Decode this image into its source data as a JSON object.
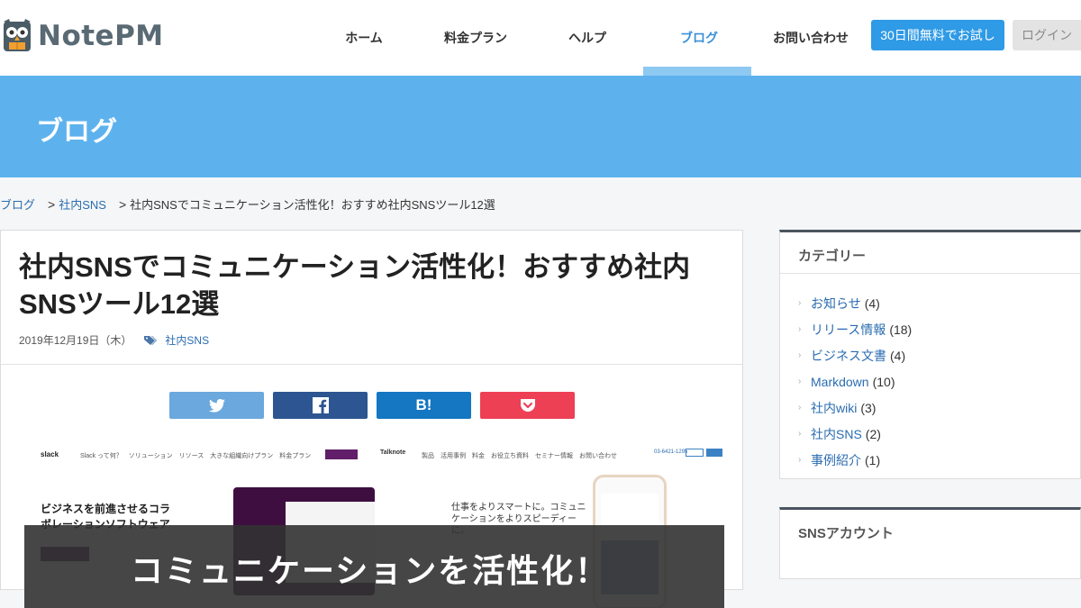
{
  "header": {
    "logo_text": "NotePM",
    "nav": [
      "ホーム",
      "料金プラン",
      "ヘルプ",
      "ブログ",
      "お問い合わせ"
    ],
    "active_nav": "ブログ",
    "trial_button": "30日間無料でお試し",
    "login_button": "ログイン"
  },
  "banner": {
    "title": "ブログ"
  },
  "breadcrumb": {
    "items": [
      "ブログ",
      "社内SNS"
    ],
    "separator": ">",
    "current": "社内SNSでコミュニケーション活性化！おすすめ社内SNSツール12選"
  },
  "article": {
    "title": "社内SNSでコミュニケーション活性化！おすすめ社内SNSツール12選",
    "date": "2019年12月19日（木）",
    "tag": "社内SNS",
    "share": {
      "hatena_label": "B!"
    },
    "hero": {
      "caption": "コミュニケーションを活性化！",
      "left_copy": "ビジネスを前進させるコラボレーションソフトウェア",
      "left_nav": "Slack って何？　ソリューション　リソース　大きな組織向けプラン　料金プラン",
      "left_brand": "slack",
      "right_copy": "仕事をよりスマートに。コミュニケーションをよりスピーディーに。",
      "right_brand": "Talknote",
      "right_nav": "製品　活用事例　料金　お役立ち資料　セミナー情報　お問い合わせ",
      "right_phone": "03-6421-1295"
    }
  },
  "sidebar": {
    "categories_heading": "カテゴリー",
    "categories": [
      {
        "name": "お知らせ",
        "count": "(4)"
      },
      {
        "name": "リリース情報",
        "count": "(18)"
      },
      {
        "name": "ビジネス文書",
        "count": "(4)"
      },
      {
        "name": "Markdown",
        "count": "(10)"
      },
      {
        "name": "社内wiki",
        "count": "(3)"
      },
      {
        "name": "社内SNS",
        "count": "(2)"
      },
      {
        "name": "事例紹介",
        "count": "(1)"
      }
    ],
    "sns_heading": "SNSアカウント"
  },
  "colors": {
    "accent": "#2f9ae6",
    "banner": "#5db2ee",
    "link": "#2a6cb0",
    "twitter": "#6aa8dd",
    "facebook": "#2c5591",
    "hatena": "#1576c2",
    "pocket": "#ee4055"
  },
  "icons": {
    "logo": "owl-logo-icon",
    "tag": "tag-icon",
    "twitter": "twitter-icon",
    "facebook": "facebook-icon",
    "pocket": "pocket-icon",
    "category_arrow": "chevron-right-icon"
  }
}
